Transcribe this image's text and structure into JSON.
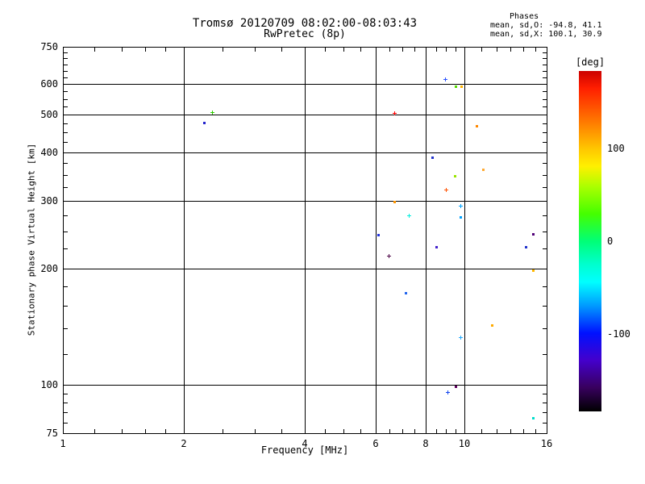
{
  "header": {
    "title_line1": "Tromsø 20120709 08:02:00-08:03:43",
    "title_line2": "RwPretec (8p)",
    "stats_title": "Phases",
    "stats_line1": "mean, sd,O: -94.8, 41.1",
    "stats_line2": "mean, sd,X: 100.1, 30.9"
  },
  "chart_data": {
    "type": "scatter",
    "title": "Tromsø 20120709 08:02:00-08:03:43 / RwPretec (8p)",
    "xlabel": "Frequency [MHz]",
    "ylabel": "Stationary phase Virtual Height [km]",
    "x_scale": "log",
    "y_scale": "log",
    "xlim": [
      1,
      16
    ],
    "ylim": [
      75,
      750
    ],
    "x_major_ticks": [
      1,
      2,
      4,
      6,
      8,
      10,
      16
    ],
    "x_minor_ticks": [
      1.2,
      1.4,
      1.6,
      1.8,
      2.5,
      3,
      3.5,
      4.5,
      5,
      5.5,
      6.5,
      7,
      7.5,
      8.5,
      9,
      9.5,
      11,
      12,
      13,
      14,
      15
    ],
    "y_major_ticks": [
      750,
      600,
      500,
      400,
      300,
      200,
      100,
      75
    ],
    "y_minor_ticks": [
      725,
      700,
      675,
      650,
      625,
      575,
      550,
      525,
      475,
      450,
      425,
      375,
      350,
      325,
      275,
      250,
      225,
      180,
      160,
      140,
      120,
      95,
      90,
      85,
      80
    ],
    "x_gridlines": [
      2,
      4,
      6,
      8,
      10
    ],
    "y_gridlines": [
      600,
      500,
      400,
      300,
      200,
      100
    ],
    "grid": true,
    "legend_position": "none",
    "points": [
      {
        "f_mhz": 2.35,
        "h_km": 508,
        "phase_deg": 25,
        "color": "#2ecc00",
        "marker": "plus"
      },
      {
        "f_mhz": 2.25,
        "h_km": 477,
        "phase_deg": -115,
        "color": "#2222cc",
        "marker": "dot"
      },
      {
        "f_mhz": 6.68,
        "h_km": 506,
        "phase_deg": 175,
        "color": "#ff0000",
        "marker": "plus"
      },
      {
        "f_mhz": 8.94,
        "h_km": 619,
        "phase_deg": -95,
        "color": "#2951ff",
        "marker": "plus"
      },
      {
        "f_mhz": 9.49,
        "h_km": 593,
        "phase_deg": 20,
        "color": "#55dd00",
        "marker": "dot"
      },
      {
        "f_mhz": 9.8,
        "h_km": 593,
        "phase_deg": 115,
        "color": "#ffb400",
        "marker": "dot"
      },
      {
        "f_mhz": 10.7,
        "h_km": 468,
        "phase_deg": 130,
        "color": "#ff8800",
        "marker": "dot"
      },
      {
        "f_mhz": 8.3,
        "h_km": 388,
        "phase_deg": -105,
        "color": "#2233cc",
        "marker": "dot"
      },
      {
        "f_mhz": 9.44,
        "h_km": 348,
        "phase_deg": 70,
        "color": "#99e600",
        "marker": "dot"
      },
      {
        "f_mhz": 11.11,
        "h_km": 361,
        "phase_deg": 110,
        "color": "#ffaa33",
        "marker": "dot"
      },
      {
        "f_mhz": 8.98,
        "h_km": 320,
        "phase_deg": 150,
        "color": "#ff5100",
        "marker": "plus"
      },
      {
        "f_mhz": 6.68,
        "h_km": 298,
        "phase_deg": 125,
        "color": "#ff9500",
        "marker": "dot"
      },
      {
        "f_mhz": 7.26,
        "h_km": 275,
        "phase_deg": -40,
        "color": "#00eedd",
        "marker": "plus"
      },
      {
        "f_mhz": 9.76,
        "h_km": 291,
        "phase_deg": -70,
        "color": "#00a2ff",
        "marker": "plus"
      },
      {
        "f_mhz": 9.76,
        "h_km": 272,
        "phase_deg": -70,
        "color": "#00a2ff",
        "marker": "dot"
      },
      {
        "f_mhz": 6.09,
        "h_km": 245,
        "phase_deg": -105,
        "color": "#2233dd",
        "marker": "dot"
      },
      {
        "f_mhz": 8.49,
        "h_km": 228,
        "phase_deg": -125,
        "color": "#4422cc",
        "marker": "dot"
      },
      {
        "f_mhz": 6.47,
        "h_km": 216,
        "phase_deg": -160,
        "color": "#500a4a",
        "marker": "plus"
      },
      {
        "f_mhz": 7.13,
        "h_km": 173,
        "phase_deg": -90,
        "color": "#2266ee",
        "marker": "dot"
      },
      {
        "f_mhz": 11.69,
        "h_km": 143,
        "phase_deg": 115,
        "color": "#ffaa00",
        "marker": "dot"
      },
      {
        "f_mhz": 9.76,
        "h_km": 133,
        "phase_deg": -65,
        "color": "#22aaff",
        "marker": "plus"
      },
      {
        "f_mhz": 9.49,
        "h_km": 99,
        "phase_deg": -165,
        "color": "#600060",
        "marker": "dot"
      },
      {
        "f_mhz": 9.06,
        "h_km": 96,
        "phase_deg": -95,
        "color": "#1144ee",
        "marker": "plus"
      },
      {
        "f_mhz": 14.79,
        "h_km": 246,
        "phase_deg": -155,
        "color": "#500078",
        "marker": "dot"
      },
      {
        "f_mhz": 14.18,
        "h_km": 228,
        "phase_deg": -105,
        "color": "#2233cc",
        "marker": "dot"
      },
      {
        "f_mhz": 14.82,
        "h_km": 198,
        "phase_deg": 110,
        "color": "#ffb800",
        "marker": "dot"
      },
      {
        "f_mhz": 14.82,
        "h_km": 82,
        "phase_deg": -35,
        "color": "#00ddcc",
        "marker": "dot"
      }
    ],
    "colorbar": {
      "label": "[deg]",
      "range": [
        -184,
        184
      ],
      "ticks": [
        {
          "value": 100,
          "label": "100"
        },
        {
          "value": 0,
          "label": "0"
        },
        {
          "value": -100,
          "label": "-100"
        }
      ],
      "gradient_top_to_bottom": [
        {
          "pos": 0.0,
          "color": "#cc0000"
        },
        {
          "pos": 0.05,
          "color": "#ff1e00"
        },
        {
          "pos": 0.15,
          "color": "#ff7a00"
        },
        {
          "pos": 0.23,
          "color": "#ffc800"
        },
        {
          "pos": 0.28,
          "color": "#fff000"
        },
        {
          "pos": 0.34,
          "color": "#aaff00"
        },
        {
          "pos": 0.42,
          "color": "#44ff00"
        },
        {
          "pos": 0.5,
          "color": "#00ff77"
        },
        {
          "pos": 0.57,
          "color": "#00ffd0"
        },
        {
          "pos": 0.62,
          "color": "#00ffff"
        },
        {
          "pos": 0.69,
          "color": "#0099ff"
        },
        {
          "pos": 0.77,
          "color": "#0011ff"
        },
        {
          "pos": 0.85,
          "color": "#4400cc"
        },
        {
          "pos": 0.93,
          "color": "#38005e"
        },
        {
          "pos": 1.0,
          "color": "#000000"
        }
      ]
    }
  }
}
